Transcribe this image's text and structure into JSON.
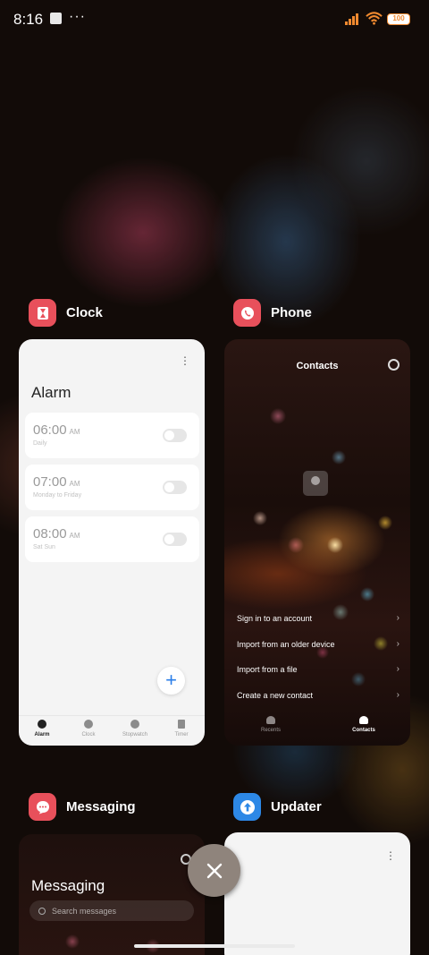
{
  "status_bar": {
    "time": "8:16",
    "dots": "···",
    "battery": "100",
    "accent_color": "#f08a30"
  },
  "apps": {
    "clock": {
      "name": "Clock",
      "icon": "hourglass-icon",
      "icon_color": "#e8505b",
      "card": {
        "menu": "⋮",
        "title": "Alarm",
        "alarms": [
          {
            "time": "06:00",
            "ampm": "AM",
            "repeat": "Daily"
          },
          {
            "time": "07:00",
            "ampm": "AM",
            "repeat": "Monday to Friday"
          },
          {
            "time": "08:00",
            "ampm": "AM",
            "repeat": "Sat Sun"
          }
        ],
        "fab": "+",
        "tabs": [
          "Alarm",
          "Clock",
          "Stopwatch",
          "Timer"
        ]
      }
    },
    "phone": {
      "name": "Phone",
      "icon": "phone-icon",
      "icon_color": "#e8505b",
      "card": {
        "title": "Contacts",
        "menu_items": [
          "Sign in to an account",
          "Import from an older device",
          "Import from a file",
          "Create a new contact"
        ],
        "chevron": "›",
        "tabs": [
          "Recents",
          "Contacts"
        ]
      }
    },
    "messaging": {
      "name": "Messaging",
      "icon": "message-icon",
      "icon_color": "#e8505b",
      "card": {
        "title": "Messaging",
        "search_placeholder": "Search messages"
      }
    },
    "updater": {
      "name": "Updater",
      "icon": "upload-arrow-icon",
      "icon_color": "#2d88e6",
      "card": {
        "menu": "⋮"
      }
    }
  },
  "clear_all": {
    "icon": "close-icon"
  }
}
